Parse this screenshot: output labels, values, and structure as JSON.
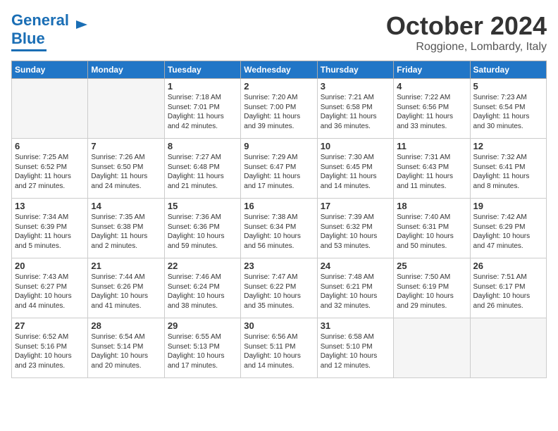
{
  "header": {
    "logo_general": "General",
    "logo_blue": "Blue",
    "month_title": "October 2024",
    "location": "Roggione, Lombardy, Italy"
  },
  "days_of_week": [
    "Sunday",
    "Monday",
    "Tuesday",
    "Wednesday",
    "Thursday",
    "Friday",
    "Saturday"
  ],
  "weeks": [
    [
      {
        "day": null,
        "empty": true
      },
      {
        "day": null,
        "empty": true
      },
      {
        "day": "1",
        "lines": [
          "Sunrise: 7:18 AM",
          "Sunset: 7:01 PM",
          "Daylight: 11 hours",
          "and 42 minutes."
        ]
      },
      {
        "day": "2",
        "lines": [
          "Sunrise: 7:20 AM",
          "Sunset: 7:00 PM",
          "Daylight: 11 hours",
          "and 39 minutes."
        ]
      },
      {
        "day": "3",
        "lines": [
          "Sunrise: 7:21 AM",
          "Sunset: 6:58 PM",
          "Daylight: 11 hours",
          "and 36 minutes."
        ]
      },
      {
        "day": "4",
        "lines": [
          "Sunrise: 7:22 AM",
          "Sunset: 6:56 PM",
          "Daylight: 11 hours",
          "and 33 minutes."
        ]
      },
      {
        "day": "5",
        "lines": [
          "Sunrise: 7:23 AM",
          "Sunset: 6:54 PM",
          "Daylight: 11 hours",
          "and 30 minutes."
        ]
      }
    ],
    [
      {
        "day": "6",
        "lines": [
          "Sunrise: 7:25 AM",
          "Sunset: 6:52 PM",
          "Daylight: 11 hours",
          "and 27 minutes."
        ]
      },
      {
        "day": "7",
        "lines": [
          "Sunrise: 7:26 AM",
          "Sunset: 6:50 PM",
          "Daylight: 11 hours",
          "and 24 minutes."
        ]
      },
      {
        "day": "8",
        "lines": [
          "Sunrise: 7:27 AM",
          "Sunset: 6:48 PM",
          "Daylight: 11 hours",
          "and 21 minutes."
        ]
      },
      {
        "day": "9",
        "lines": [
          "Sunrise: 7:29 AM",
          "Sunset: 6:47 PM",
          "Daylight: 11 hours",
          "and 17 minutes."
        ]
      },
      {
        "day": "10",
        "lines": [
          "Sunrise: 7:30 AM",
          "Sunset: 6:45 PM",
          "Daylight: 11 hours",
          "and 14 minutes."
        ]
      },
      {
        "day": "11",
        "lines": [
          "Sunrise: 7:31 AM",
          "Sunset: 6:43 PM",
          "Daylight: 11 hours",
          "and 11 minutes."
        ]
      },
      {
        "day": "12",
        "lines": [
          "Sunrise: 7:32 AM",
          "Sunset: 6:41 PM",
          "Daylight: 11 hours",
          "and 8 minutes."
        ]
      }
    ],
    [
      {
        "day": "13",
        "lines": [
          "Sunrise: 7:34 AM",
          "Sunset: 6:39 PM",
          "Daylight: 11 hours",
          "and 5 minutes."
        ]
      },
      {
        "day": "14",
        "lines": [
          "Sunrise: 7:35 AM",
          "Sunset: 6:38 PM",
          "Daylight: 11 hours",
          "and 2 minutes."
        ]
      },
      {
        "day": "15",
        "lines": [
          "Sunrise: 7:36 AM",
          "Sunset: 6:36 PM",
          "Daylight: 10 hours",
          "and 59 minutes."
        ]
      },
      {
        "day": "16",
        "lines": [
          "Sunrise: 7:38 AM",
          "Sunset: 6:34 PM",
          "Daylight: 10 hours",
          "and 56 minutes."
        ]
      },
      {
        "day": "17",
        "lines": [
          "Sunrise: 7:39 AM",
          "Sunset: 6:32 PM",
          "Daylight: 10 hours",
          "and 53 minutes."
        ]
      },
      {
        "day": "18",
        "lines": [
          "Sunrise: 7:40 AM",
          "Sunset: 6:31 PM",
          "Daylight: 10 hours",
          "and 50 minutes."
        ]
      },
      {
        "day": "19",
        "lines": [
          "Sunrise: 7:42 AM",
          "Sunset: 6:29 PM",
          "Daylight: 10 hours",
          "and 47 minutes."
        ]
      }
    ],
    [
      {
        "day": "20",
        "lines": [
          "Sunrise: 7:43 AM",
          "Sunset: 6:27 PM",
          "Daylight: 10 hours",
          "and 44 minutes."
        ]
      },
      {
        "day": "21",
        "lines": [
          "Sunrise: 7:44 AM",
          "Sunset: 6:26 PM",
          "Daylight: 10 hours",
          "and 41 minutes."
        ]
      },
      {
        "day": "22",
        "lines": [
          "Sunrise: 7:46 AM",
          "Sunset: 6:24 PM",
          "Daylight: 10 hours",
          "and 38 minutes."
        ]
      },
      {
        "day": "23",
        "lines": [
          "Sunrise: 7:47 AM",
          "Sunset: 6:22 PM",
          "Daylight: 10 hours",
          "and 35 minutes."
        ]
      },
      {
        "day": "24",
        "lines": [
          "Sunrise: 7:48 AM",
          "Sunset: 6:21 PM",
          "Daylight: 10 hours",
          "and 32 minutes."
        ]
      },
      {
        "day": "25",
        "lines": [
          "Sunrise: 7:50 AM",
          "Sunset: 6:19 PM",
          "Daylight: 10 hours",
          "and 29 minutes."
        ]
      },
      {
        "day": "26",
        "lines": [
          "Sunrise: 7:51 AM",
          "Sunset: 6:17 PM",
          "Daylight: 10 hours",
          "and 26 minutes."
        ]
      }
    ],
    [
      {
        "day": "27",
        "lines": [
          "Sunrise: 6:52 AM",
          "Sunset: 5:16 PM",
          "Daylight: 10 hours",
          "and 23 minutes."
        ]
      },
      {
        "day": "28",
        "lines": [
          "Sunrise: 6:54 AM",
          "Sunset: 5:14 PM",
          "Daylight: 10 hours",
          "and 20 minutes."
        ]
      },
      {
        "day": "29",
        "lines": [
          "Sunrise: 6:55 AM",
          "Sunset: 5:13 PM",
          "Daylight: 10 hours",
          "and 17 minutes."
        ]
      },
      {
        "day": "30",
        "lines": [
          "Sunrise: 6:56 AM",
          "Sunset: 5:11 PM",
          "Daylight: 10 hours",
          "and 14 minutes."
        ]
      },
      {
        "day": "31",
        "lines": [
          "Sunrise: 6:58 AM",
          "Sunset: 5:10 PM",
          "Daylight: 10 hours",
          "and 12 minutes."
        ]
      },
      {
        "day": null,
        "empty": true
      },
      {
        "day": null,
        "empty": true
      }
    ]
  ]
}
